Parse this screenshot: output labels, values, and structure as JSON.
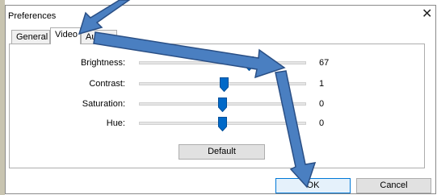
{
  "window": {
    "title": "Preferences",
    "close_glyph": "✕"
  },
  "tabs": [
    {
      "label": "General",
      "active": false
    },
    {
      "label": "Video",
      "active": true
    },
    {
      "label": "Audio",
      "active": false
    }
  ],
  "sliders": [
    {
      "label": "Brightness:",
      "value": "67",
      "level": 0.67
    },
    {
      "label": "Contrast:",
      "value": "1",
      "level": 0.51
    },
    {
      "label": "Saturation:",
      "value": "0",
      "level": 0.5
    },
    {
      "label": "Hue:",
      "value": "0",
      "level": 0.5
    }
  ],
  "buttons": {
    "default_label": "Default",
    "ok_label": "OK",
    "cancel_label": "Cancel"
  },
  "colors": {
    "accent": "#0078d7",
    "thumb": "#0069c8",
    "annotation_arrow": "#4a7fc1",
    "annotation_arrow_border": "#2a4f85"
  },
  "annotations": [
    {
      "kind": "arrow",
      "points_to": "tab-video"
    },
    {
      "kind": "arrow",
      "points_to": "brightness-slider-thumb"
    },
    {
      "kind": "arrow",
      "points_to": "ok-button"
    }
  ]
}
